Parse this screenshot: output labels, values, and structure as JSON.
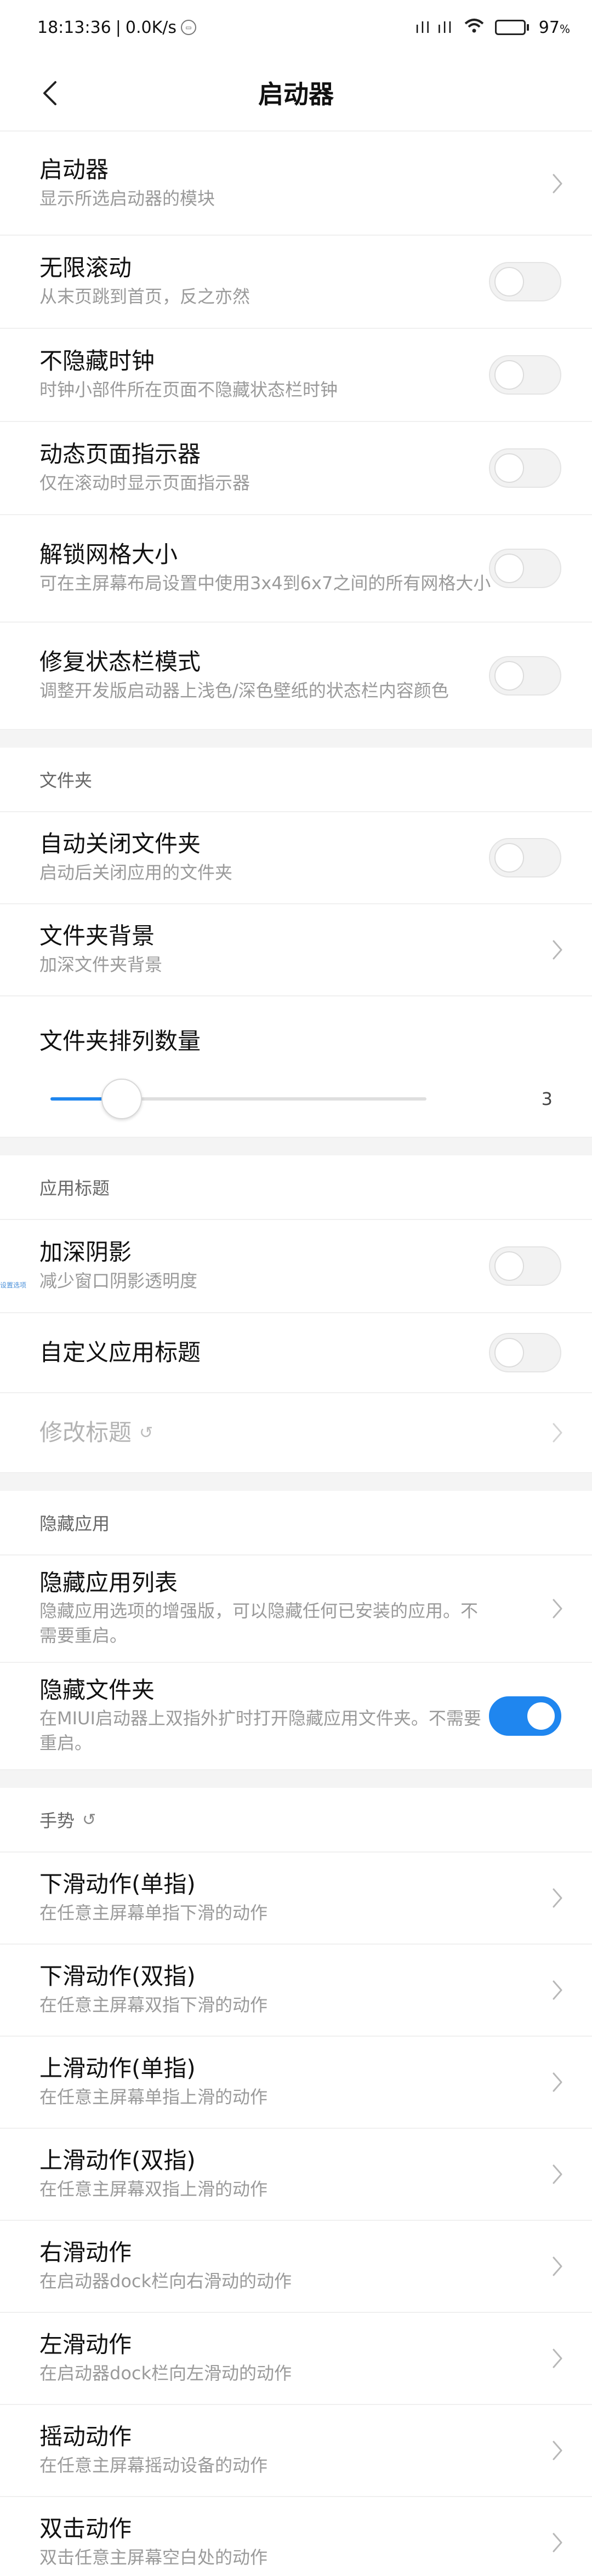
{
  "status_bar": {
    "time": "18:13:36",
    "separator": "|",
    "net_speed": "0.0K/s",
    "signal": "ıll ıll",
    "wifi": "◠",
    "battery_percent": "97",
    "battery_level": 0.97,
    "battery_color": "#2bbd45"
  },
  "header": {
    "title": "启动器"
  },
  "general": [
    {
      "title": "启动器",
      "subtitle": "显示所选启动器的模块",
      "control": "chevron"
    },
    {
      "title": "无限滚动",
      "subtitle": "从末页跳到首页，反之亦然",
      "control": "toggle",
      "on": false
    },
    {
      "title": "不隐藏时钟",
      "subtitle": "时钟小部件所在页面不隐藏状态栏时钟",
      "control": "toggle",
      "on": false
    },
    {
      "title": "动态页面指示器",
      "subtitle": "仅在滚动时显示页面指示器",
      "control": "toggle",
      "on": false
    },
    {
      "title": "解锁网格大小",
      "subtitle": "可在主屏幕布局设置中使用3x4到6x7之间的所有网格大小",
      "control": "toggle",
      "on": false
    },
    {
      "title": "修复状态栏模式",
      "subtitle": "调整开发版启动器上浅色/深色壁纸的状态栏内容颜色",
      "control": "toggle",
      "on": false
    }
  ],
  "folders": {
    "header": "文件夹",
    "items": [
      {
        "title": "自动关闭文件夹",
        "subtitle": "启动后关闭应用的文件夹",
        "control": "toggle",
        "on": false
      },
      {
        "title": "文件夹背景",
        "subtitle": "加深文件夹背景",
        "control": "chevron"
      }
    ],
    "columns": {
      "title": "文件夹排列数量",
      "value": "3",
      "fraction": 0.19
    }
  },
  "app_titles": {
    "header": "应用标题",
    "items": [
      {
        "title": "加深阴影",
        "subtitle": "减少窗口阴影透明度",
        "control": "toggle",
        "on": false
      },
      {
        "title": "自定义应用标题",
        "subtitle": "",
        "control": "toggle",
        "on": false
      }
    ],
    "edit": {
      "title": "修改标题",
      "reset_icon": "↺"
    },
    "tag": "设置选项"
  },
  "hidden_apps": {
    "header": "隐藏应用",
    "items": [
      {
        "title": "隐藏应用列表",
        "subtitle": "隐藏应用选项的增强版，可以隐藏任何已安装的应用。不需要重启。",
        "control": "chevron"
      },
      {
        "title": "隐藏文件夹",
        "subtitle": "在MIUI启动器上双指外扩时打开隐藏应用文件夹。不需要重启。",
        "control": "toggle",
        "on": true
      }
    ]
  },
  "gestures": {
    "header": "手势",
    "reset_icon": "↺",
    "items": [
      {
        "title": "下滑动作(单指)",
        "subtitle": "在任意主屏幕单指下滑的动作",
        "control": "chevron"
      },
      {
        "title": "下滑动作(双指)",
        "subtitle": "在任意主屏幕双指下滑的动作",
        "control": "chevron"
      },
      {
        "title": "上滑动作(单指)",
        "subtitle": "在任意主屏幕单指上滑的动作",
        "control": "chevron"
      },
      {
        "title": "上滑动作(双指)",
        "subtitle": "在任意主屏幕双指上滑的动作",
        "control": "chevron"
      },
      {
        "title": "右滑动作",
        "subtitle": "在启动器dock栏向右滑动的动作",
        "control": "chevron"
      },
      {
        "title": "左滑动作",
        "subtitle": "在启动器dock栏向左滑动的动作",
        "control": "chevron"
      },
      {
        "title": "摇动动作",
        "subtitle": "在任意主屏幕摇动设备的动作",
        "control": "chevron"
      },
      {
        "title": "双击动作",
        "subtitle": "双击任意主屏幕空白处的动作",
        "control": "chevron"
      }
    ]
  },
  "colors": {
    "accent": "#1f86ef",
    "section_gap": "#f4f4f4",
    "subtitle": "#9a9a9a"
  }
}
